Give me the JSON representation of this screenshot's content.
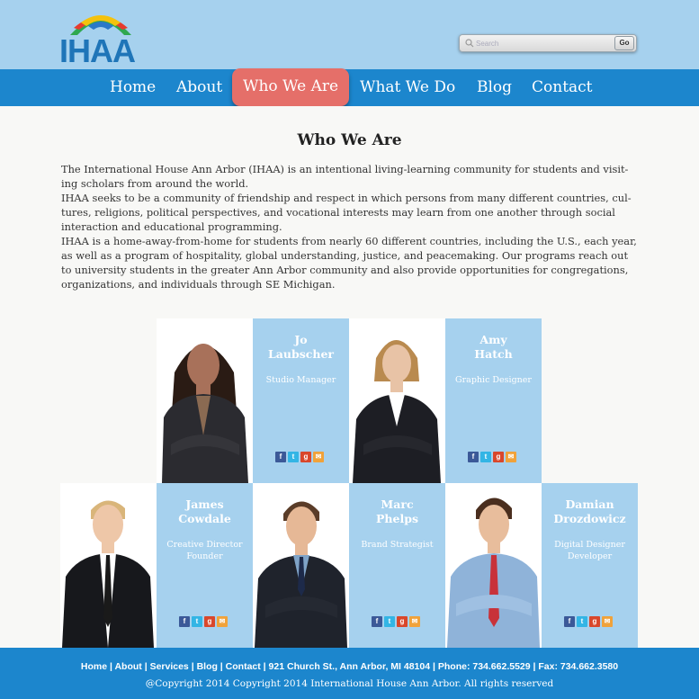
{
  "brand": {
    "logo_text": "IHAA",
    "accent": "#1c86cd",
    "light_blue": "#a6d1ee",
    "active_nav": "#e56f69"
  },
  "search": {
    "placeholder": "Search",
    "go_label": "Go"
  },
  "nav": {
    "items": [
      {
        "label": "Home"
      },
      {
        "label": "About"
      },
      {
        "label": "Who We Are",
        "active": true
      },
      {
        "label": "What We Do"
      },
      {
        "label": "Blog"
      },
      {
        "label": "Contact"
      }
    ]
  },
  "main": {
    "title": "Who We Are",
    "paragraphs": [
      "The International House Ann Arbor (IHAA) is an intentional living-learning community for students and visit-ing scholars from around the world.",
      "IHAA seeks to be a community of friendship and respect in which persons from many different countries, cul-tures, religions, political perspectives, and vocational interests may learn from one another through social interaction and educational programming.",
      "IHAA is a home-away-from-home for students from nearly 60 different countries, including the U.S., each year, as well as a program of hospitality, global understanding, justice, and peacemaking. Our programs reach out to university students in the greater Ann Arbor community and also provide opportunities for congregations, organizations, and individuals through SE Michigan."
    ]
  },
  "team": [
    {
      "first": "Jo",
      "last": "Laubscher",
      "role_line1": "Studio Manager",
      "role_line2": ""
    },
    {
      "first": "Amy",
      "last": "Hatch",
      "role_line1": "Graphic Designer",
      "role_line2": ""
    },
    {
      "first": "James",
      "last": "Cowdale",
      "role_line1": "Creative Director",
      "role_line2": "Founder"
    },
    {
      "first": "Marc",
      "last": "Phelps",
      "role_line1": "Brand Strategist",
      "role_line2": ""
    },
    {
      "first": "Damian",
      "last": "Drozdowicz",
      "role_line1": "Digital Designer",
      "role_line2": "Developer"
    }
  ],
  "social_icons": [
    "facebook-icon",
    "twitter-icon",
    "google-plus-icon",
    "email-icon"
  ],
  "footer": {
    "links": [
      "Home",
      "About",
      "Services",
      "Blog",
      "Contact"
    ],
    "address": "921 Church St., Ann Arbor, MI 48104",
    "phone": "Phone: 734.662.5529",
    "fax": "Fax: 734.662.3580",
    "copyright": "@Copyright 2014 Copyright 2014 International House Ann Arbor. All rights reserved"
  }
}
